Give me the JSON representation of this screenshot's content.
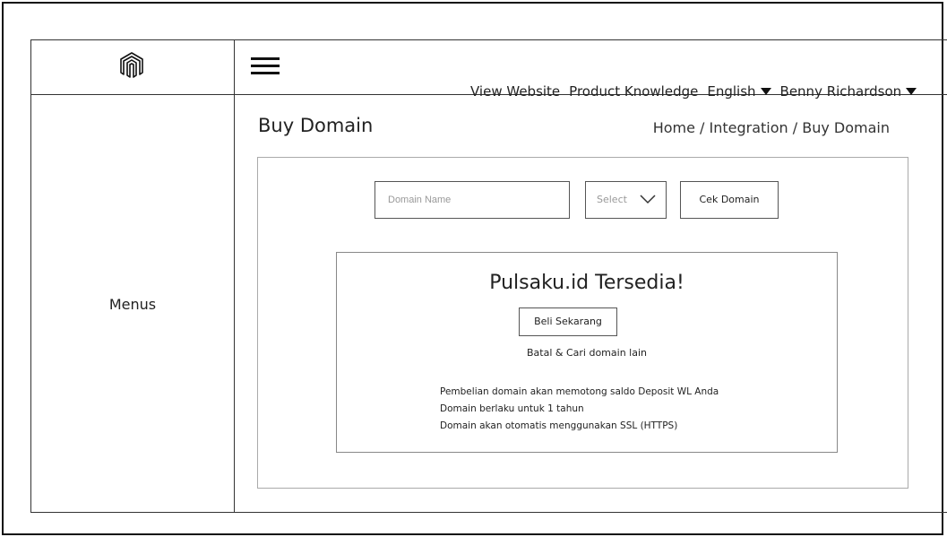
{
  "header": {
    "nav_view_website": "View Website",
    "nav_product_knowledge": "Product Knowledge",
    "nav_language": "English",
    "nav_user": "Benny Richardson"
  },
  "sidebar": {
    "menus_label": "Menus"
  },
  "page": {
    "title": "Buy Domain",
    "breadcrumb": "Home / Integration / Buy Domain"
  },
  "search": {
    "domain_placeholder": "Domain Name",
    "tld_select_value": "Select",
    "cek_button": "Cek Domain"
  },
  "result": {
    "title": "Pulsaku.id Tersedia!",
    "buy_button": "Beli Sekarang",
    "cancel_link": "Batal & Cari domain lain",
    "notes": [
      "Pembelian domain akan memotong saldo Deposit WL Anda",
      "Domain berlaku untuk 1 tahun",
      "Domain akan otomatis menggunakan SSL (HTTPS)"
    ]
  },
  "icons": {
    "logo": "magento-logo-icon",
    "menu": "hamburger-menu-icon",
    "dropdown": "caret-down-icon",
    "select": "chevron-down-icon"
  }
}
